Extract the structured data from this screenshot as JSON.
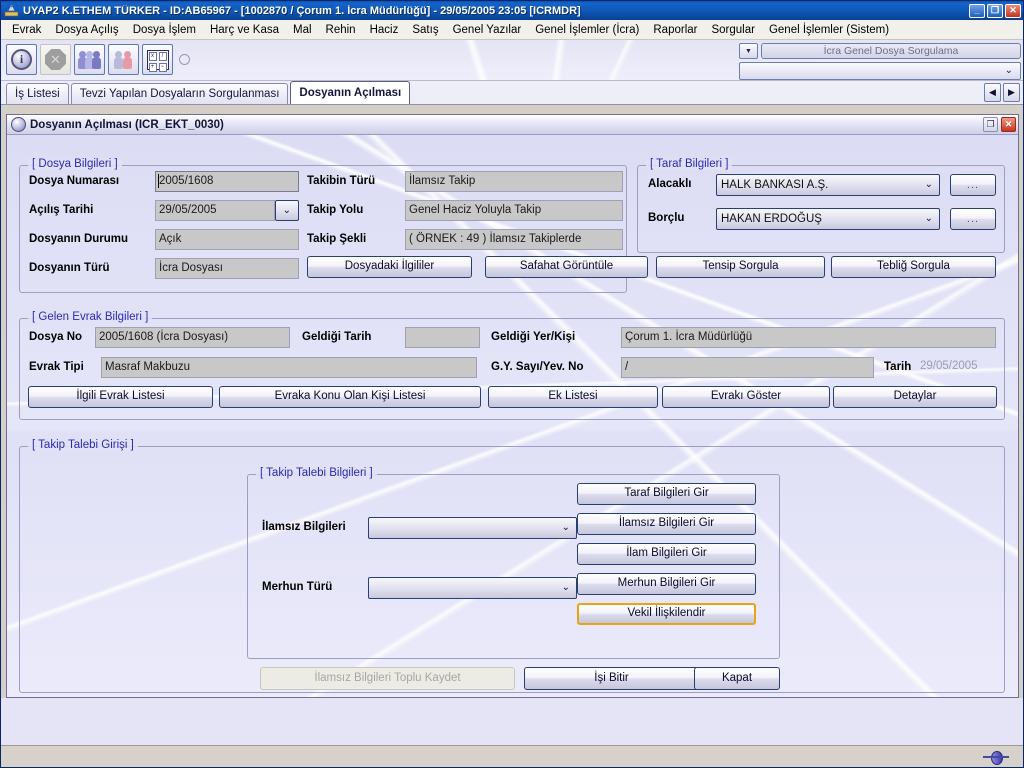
{
  "window": {
    "title": "UYAP2   K.ETHEM TÜRKER - ID:AB65967 - [1002870 / Çorum 1. İcra Müdürlüğü] - 29/05/2005 23:05 [ICRMDR]",
    "minimize_label": "_",
    "restore_label": "❐",
    "close_label": "✕"
  },
  "menubar": {
    "items": [
      {
        "label": "Evrak"
      },
      {
        "label": "Dosya Açılış"
      },
      {
        "label": "Dosya İşlem"
      },
      {
        "label": "Harç ve Kasa"
      },
      {
        "label": "Mal"
      },
      {
        "label": "Rehin"
      },
      {
        "label": "Haciz"
      },
      {
        "label": "Satış"
      },
      {
        "label": "Genel Yazılar"
      },
      {
        "label": "Genel İşlemler (İcra)"
      },
      {
        "label": "Raporlar"
      },
      {
        "label": "Sorgular"
      },
      {
        "label": "Genel İşlemler (Sistem)"
      }
    ]
  },
  "toolbar": {
    "buttons": [
      {
        "name": "info-icon",
        "enabled": true
      },
      {
        "name": "stop-icon",
        "enabled": false
      },
      {
        "name": "people-group-icon",
        "enabled": true
      },
      {
        "name": "two-persons-icon",
        "enabled": true
      },
      {
        "name": "calculator-icon",
        "enabled": true
      }
    ],
    "query_pill": "İcra Genel Dosya Sorgulama",
    "query_combo_value": "",
    "dropdown_caret": "▼",
    "combo_caret": "⌄"
  },
  "tabs": {
    "items": [
      {
        "label": "İş Listesi",
        "active": false
      },
      {
        "label": "Tevzi Yapılan Dosyaların Sorgulanması",
        "active": false
      },
      {
        "label": "Dosyanın Açılması",
        "active": true
      }
    ],
    "prev_label": "◀",
    "next_label": "▶"
  },
  "mdi": {
    "title": "Dosyanın Açılması (ICR_EKT_0030)",
    "restore_label": "❐",
    "close_label": "✕"
  },
  "dosya_bilgileri": {
    "legend": "[ Dosya Bilgileri ]",
    "fields": [
      {
        "label": "Dosya Numarası",
        "value": "2005/1608"
      },
      {
        "label": "Açılış Tarihi",
        "value": "29/05/2005"
      },
      {
        "label": "Dosyanın Durumu",
        "value": "Açık"
      },
      {
        "label": "Dosyanın Türü",
        "value": "İcra Dosyası"
      }
    ],
    "right_fields": [
      {
        "label": "Takibin Türü",
        "value": "İlamsız Takip"
      },
      {
        "label": "Takip Yolu",
        "value": "Genel Haciz Yoluyla Takip"
      },
      {
        "label": "Takip Şekli",
        "value": "( ÖRNEK  : 49 ) İlamsız Takiplerde"
      }
    ],
    "date_caret": "⌄",
    "buttons": [
      {
        "label": "Dosyadaki İlgililer",
        "accesskey": "y"
      },
      {
        "label": "Safahat Görüntüle",
        "accesskey": "f"
      },
      {
        "label": "Tensip Sorgula",
        "accesskey": "n"
      },
      {
        "label": "Tebliğ Sorgula",
        "accesskey": "g"
      }
    ]
  },
  "taraf_bilgileri": {
    "legend": "[ Taraf Bilgileri ]",
    "rows": [
      {
        "label": "Alacaklı",
        "value": "HALK BANKASI A.Ş.",
        "button": "..."
      },
      {
        "label": "Borçlu",
        "value": "HAKAN ERDOĞUŞ",
        "button": "..."
      }
    ],
    "caret": "⌄"
  },
  "gelen_evrak": {
    "legend": "[ Gelen Evrak Bilgileri ]",
    "dosya_no_label": "Dosya No",
    "dosya_no_value": "2005/1608 (İcra Dosyası)",
    "geldigi_tarih_label": "Geldiği Tarih",
    "geldigi_tarih_value": "",
    "geldigi_yer_label": "Geldiği Yer/Kişi",
    "geldigi_yer_value": "Çorum 1. İcra Müdürlüğü",
    "evrak_tipi_label": "Evrak Tipi",
    "evrak_tipi_value": "Masraf Makbuzu",
    "gy_sayi_label": "G.Y. Sayı/Yev. No",
    "gy_sayi_value": "/",
    "tarih_label": "Tarih",
    "tarih_value": "29/05/2005",
    "buttons": [
      {
        "label": "İlgili Evrak Listesi",
        "accesskey": "l"
      },
      {
        "label": "Evraka Konu Olan Kişi Listesi",
        "accesskey": "v"
      },
      {
        "label": "Ek Listesi",
        "accesskey": "E"
      },
      {
        "label": "Evrakı Göster",
        "accesskey": "G"
      },
      {
        "label": "Detaylar",
        "accesskey": "r"
      }
    ]
  },
  "takip_talebi": {
    "outer_legend": "[ Takip Talebi Girişi ]",
    "inner_legend": "[ Takip Talebi Bilgileri ]",
    "ilamsiz_label": "İlamsız Bilgileri",
    "ilamsiz_value": "",
    "merhun_label": "Merhun Türü",
    "merhun_value": "",
    "caret": "⌄",
    "buttons": [
      {
        "label": "Taraf Bilgileri Gir",
        "highlight": false
      },
      {
        "label": "İlamsız Bilgileri Gir",
        "highlight": false
      },
      {
        "label": "İlam Bilgileri Gir",
        "highlight": false
      },
      {
        "label": "Merhun Bilgileri Gir",
        "highlight": false
      },
      {
        "label": "Vekil İlişkilendir",
        "highlight": true
      }
    ]
  },
  "footer": {
    "toplu_kaydet": "İlamsız Bilgileri Toplu Kaydet",
    "isi_bitir": "İşi Bitir",
    "kapat": "Kapat"
  },
  "statusbar": {
    "icon": "network-connection-icon"
  },
  "colors": {
    "title_blue": "#0e59bb",
    "legend_blue": "#2b2bb0",
    "highlight_orange": "#e8a317",
    "field_gray": "#c8c8c8",
    "close_red": "#c5341c"
  }
}
